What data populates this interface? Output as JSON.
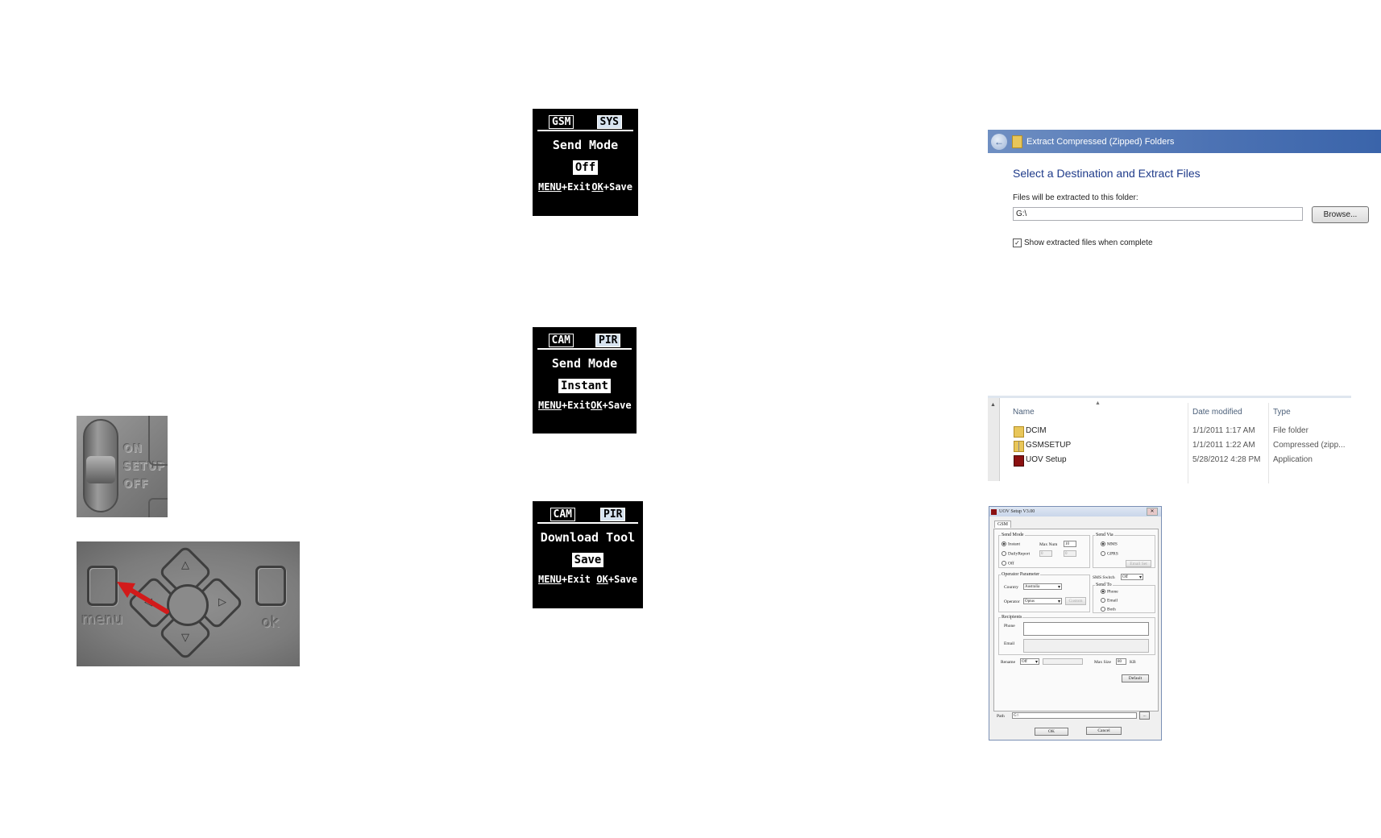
{
  "photos": {
    "switch": {
      "labels": [
        "ON",
        "SETUP",
        "OFF"
      ]
    },
    "keypad": {
      "menu_label": "menu",
      "ok_label": "ok",
      "up": "△",
      "down": "▽",
      "right": "▷",
      "left": "◁"
    }
  },
  "lcd_screens": [
    {
      "tabs": [
        "GSM",
        "SYS"
      ],
      "active_tab": 1,
      "title": "Send Mode",
      "value": "Off",
      "left_key": "MENU",
      "left_action": "+Exit",
      "right_key": "OK",
      "right_action": "+Save"
    },
    {
      "tabs": [
        "CAM",
        "PIR"
      ],
      "active_tab": 1,
      "title": "Send Mode",
      "value": "Instant",
      "left_key": "MENU",
      "left_action": "+Exit",
      "right_key": "OK",
      "right_action": "+Save"
    },
    {
      "tabs": [
        "CAM",
        "PIR"
      ],
      "active_tab": 1,
      "title": "Download Tool",
      "value": "Save",
      "left_key": "MENU",
      "left_action": "+Exit",
      "right_key": "OK",
      "right_action": "+Save"
    }
  ],
  "extract_dialog": {
    "title": "Extract Compressed (Zipped) Folders",
    "heading": "Select a Destination and Extract Files",
    "files_label": "Files will be extracted to this folder:",
    "path_value": "G:\\",
    "browse_label": "Browse...",
    "show_files_label": "Show extracted files when complete",
    "show_files_checked": true
  },
  "file_list": {
    "columns": [
      "Name",
      "Date modified",
      "Type"
    ],
    "rows": [
      {
        "name": "DCIM",
        "date": "1/1/2011 1:17 AM",
        "type": "File folder",
        "icon": "folder-icon"
      },
      {
        "name": "GSMSETUP",
        "date": "1/1/2011 1:22 AM",
        "type": "Compressed (zipp...",
        "icon": "zip-folder-icon"
      },
      {
        "name": "UOV Setup",
        "date": "5/28/2012 4:28 PM",
        "type": "Application",
        "icon": "app-icon"
      }
    ]
  },
  "uov_dialog": {
    "title": "UOV Setup V3.00",
    "close": "✕",
    "tab": "GSM",
    "send_mode": {
      "legend": "Send Mode",
      "options": [
        "Instant",
        "DailyReport",
        "Off"
      ],
      "selected": 0,
      "max_num_label": "Max Num",
      "max_num_value": "10",
      "daily_a": "0",
      "daily_b": "0"
    },
    "send_via": {
      "legend": "Send Via",
      "options": [
        "MMS",
        "GPRS"
      ],
      "selected": 0,
      "email_set": "Email Set"
    },
    "operator": {
      "legend": "Operator Parameter",
      "country_label": "Country",
      "country_value": "Australia",
      "operator_label": "Operator",
      "operator_value": "Optus",
      "custom_label": "Custom"
    },
    "sms_switch": {
      "label": "SMS Switch",
      "value": "Off"
    },
    "send_to": {
      "legend": "Send To",
      "options": [
        "Phone",
        "Email",
        "Both"
      ],
      "selected": 0
    },
    "recipients": {
      "legend": "Recipients",
      "phone_label": "Phone",
      "email_label": "Email"
    },
    "rename_label": "Rename",
    "rename_value": "Off",
    "max_size_label": "Max Size",
    "max_size_value": "80",
    "max_size_unit": "KB",
    "default_label": "Default",
    "path_label": "Path",
    "path_value": "G:\\",
    "path_browse": "...",
    "ok_label": "OK",
    "cancel_label": "Cancel"
  }
}
